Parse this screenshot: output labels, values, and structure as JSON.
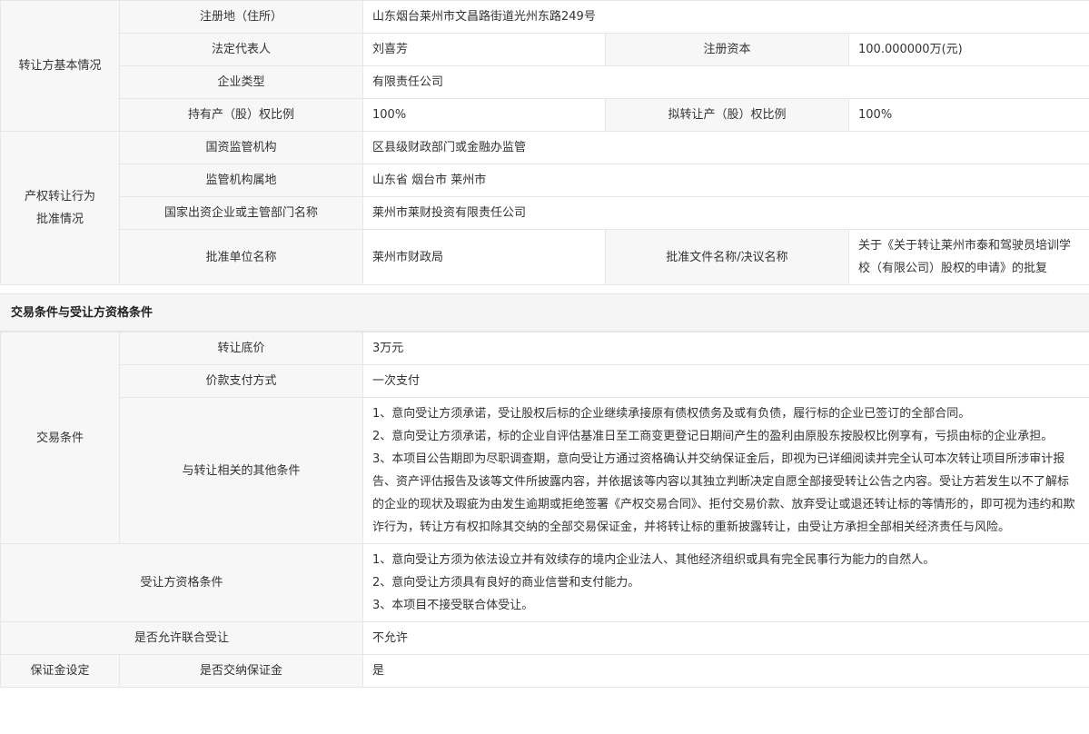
{
  "basic_info": {
    "group_label": "转让方基本情况",
    "rows": [
      {
        "label": "注册地（住所）",
        "value": "山东烟台莱州市文昌路街道光州东路249号"
      },
      {
        "label": "法定代表人",
        "value": "刘喜芳",
        "label2": "注册资本",
        "value2": "100.000000万(元)"
      },
      {
        "label": "企业类型",
        "value": "有限责任公司"
      },
      {
        "label": "持有产（股）权比例",
        "value": "100%",
        "label2": "拟转让产（股）权比例",
        "value2": "100%"
      }
    ]
  },
  "approval_info": {
    "group_label_line1": "产权转让行为",
    "group_label_line2": "批准情况",
    "rows": [
      {
        "label": "国资监管机构",
        "value": "区县级财政部门或金融办监管"
      },
      {
        "label": "监管机构属地",
        "value": "山东省 烟台市 莱州市"
      },
      {
        "label": "国家出资企业或主管部门名称",
        "value": "莱州市莱财投资有限责任公司"
      },
      {
        "label": "批准单位名称",
        "value": "莱州市财政局",
        "label2": "批准文件名称/决议名称",
        "value2": "关于《关于转让莱州市泰和驾驶员培训学校（有限公司）股权的申请》的批复"
      }
    ]
  },
  "section_title": "交易条件与受让方资格条件",
  "trade_conditions": {
    "group_label": "交易条件",
    "reserve_price_label": "转让底价",
    "reserve_price": "3万元",
    "payment_label": "价款支付方式",
    "payment": "一次支付",
    "other_label": "与转让相关的其他条件",
    "other_items": [
      "1、意向受让方须承诺，受让股权后标的企业继续承接原有债权债务及或有负债，履行标的企业已签订的全部合同。",
      "2、意向受让方须承诺，标的企业自评估基准日至工商变更登记日期间产生的盈利由原股东按股权比例享有，亏损由标的企业承担。",
      "3、本项目公告期即为尽职调查期，意向受让方通过资格确认并交纳保证金后，即视为已详细阅读并完全认可本次转让项目所涉审计报告、资产评估报告及该等文件所披露内容，并依据该等内容以其独立判断决定自愿全部接受转让公告之内容。受让方若发生以不了解标的企业的现状及瑕疵为由发生逾期或拒绝签署《产权交易合同》、拒付交易价款、放弃受让或退还转让标的等情形的，即可视为违约和欺诈行为，转让方有权扣除其交纳的全部交易保证金，并将转让标的重新披露转让，由受让方承担全部相关经济责任与风险。"
    ]
  },
  "buyer_qualification": {
    "label": "受让方资格条件",
    "items": [
      "1、意向受让方须为依法设立并有效续存的境内企业法人、其他经济组织或具有完全民事行为能力的自然人。",
      "2、意向受让方须具有良好的商业信誉和支付能力。",
      "3、本项目不接受联合体受让。"
    ]
  },
  "joint_bid": {
    "label": "是否允许联合受让",
    "value": "不允许"
  },
  "deposit": {
    "group_label": "保证金设定",
    "label": "是否交纳保证金",
    "value": "是"
  }
}
